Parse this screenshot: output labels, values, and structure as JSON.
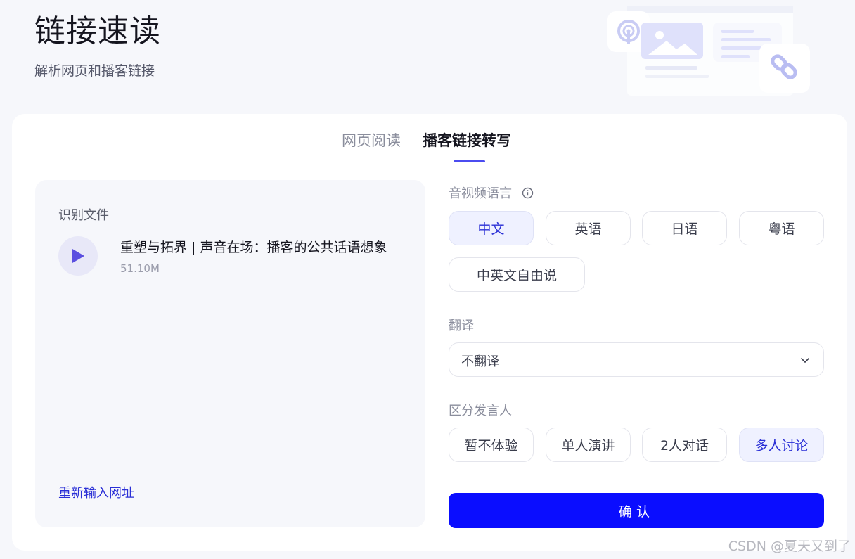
{
  "header": {
    "title": "链接速读",
    "subtitle": "解析网页和播客链接"
  },
  "tabs": [
    {
      "label": "网页阅读",
      "active": false
    },
    {
      "label": "播客链接转写",
      "active": true
    }
  ],
  "file_panel": {
    "title": "识别文件",
    "file_name": "重塑与拓界 | 声音在场：播客的公共话语想象",
    "file_size": "51.10M",
    "reenter_link": "重新输入网址"
  },
  "settings": {
    "language": {
      "label": "音视频语言",
      "info_icon": "info-icon",
      "options": [
        "中文",
        "英语",
        "日语",
        "粤语",
        "中英文自由说"
      ],
      "selected": "中文"
    },
    "translation": {
      "label": "翻译",
      "value": "不翻译"
    },
    "speaker": {
      "label": "区分发言人",
      "options": [
        "暂不体验",
        "单人演讲",
        "2人对话",
        "多人讨论"
      ],
      "selected": "多人讨论"
    },
    "confirm_label": "确认"
  },
  "colors": {
    "accent": "#0a0dff",
    "link": "#2a2fd6",
    "selected_bg": "#eff1ff",
    "page_bg": "#f6f7fb"
  },
  "watermark": "CSDN @夏天又到了"
}
